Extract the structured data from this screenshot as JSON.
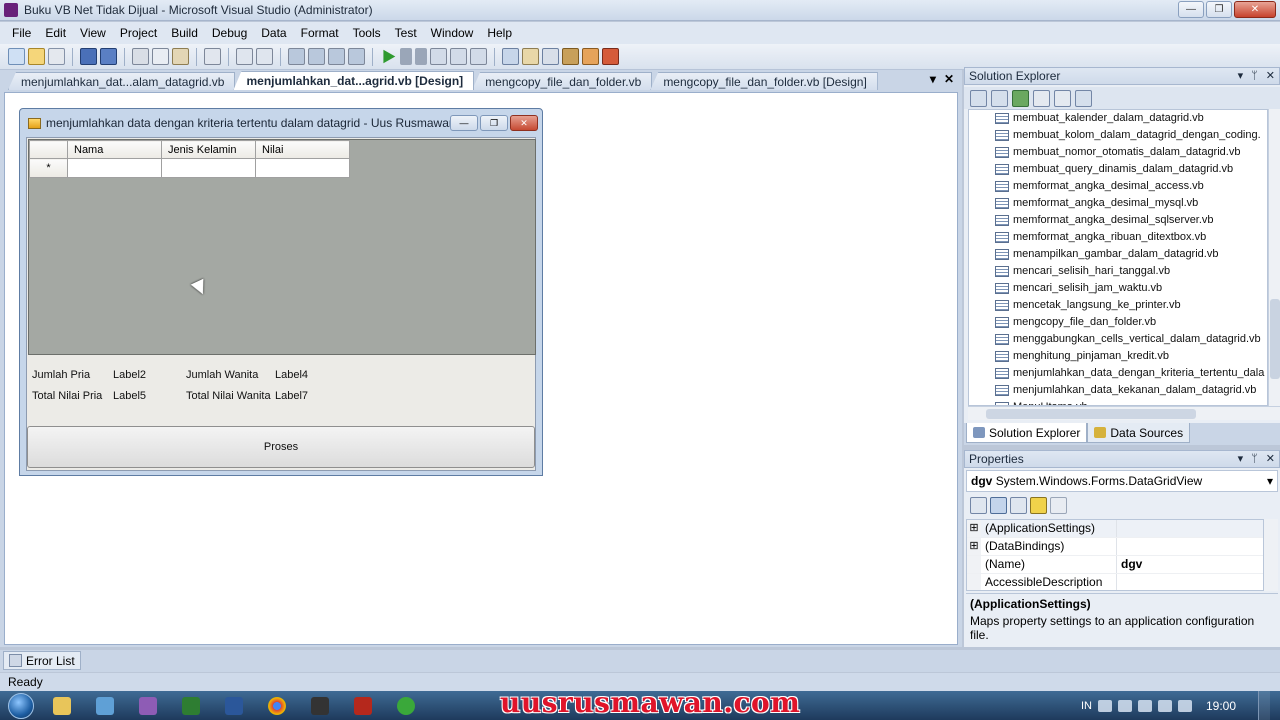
{
  "window": {
    "title": "Buku VB Net Tidak Dijual - Microsoft Visual Studio (Administrator)",
    "min_label": "—",
    "max_label": "❐",
    "close_label": "✕"
  },
  "menu": [
    "File",
    "Edit",
    "View",
    "Project",
    "Build",
    "Debug",
    "Data",
    "Format",
    "Tools",
    "Test",
    "Window",
    "Help"
  ],
  "doc_tabs": [
    {
      "label": "menjumlahkan_dat...alam_datagrid.vb",
      "active": false
    },
    {
      "label": "menjumlahkan_dat...agrid.vb [Design]",
      "active": true
    },
    {
      "label": "mengcopy_file_dan_folder.vb",
      "active": false
    },
    {
      "label": "mengcopy_file_dan_folder.vb [Design]",
      "active": false
    }
  ],
  "tab_controls": {
    "dropdown": "▾",
    "close": "✕"
  },
  "form": {
    "title": "menjumlahkan data dengan kriteria tertentu dalam datagrid - Uus Rusmawan",
    "grid": {
      "columns": [
        "Nama",
        "Jenis Kelamin",
        "Nilai"
      ],
      "new_row_marker": "*"
    },
    "labels": {
      "jumlah_pria": "Jumlah Pria",
      "label2": "Label2",
      "jumlah_wanita": "Jumlah Wanita",
      "label4": "Label4",
      "total_nilai_pria": "Total Nilai Pria",
      "label5": "Label5",
      "total_nilai_wanita": "Total Nilai Wanita",
      "label7": "Label7"
    },
    "button_label": "Proses"
  },
  "solution_explorer": {
    "title": "Solution Explorer",
    "controls": {
      "dropdown": "▾",
      "pin": "ᛘ",
      "close": "✕"
    },
    "files": [
      "membuat_kalender_dalam_datagrid.vb",
      "membuat_kolom_dalam_datagrid_dengan_coding.",
      "membuat_nomor_otomatis_dalam_datagrid.vb",
      "membuat_query_dinamis_dalam_datagrid.vb",
      "memformat_angka_desimal_access.vb",
      "memformat_angka_desimal_mysql.vb",
      "memformat_angka_desimal_sqlserver.vb",
      "memformat_angka_ribuan_ditextbox.vb",
      "menampilkan_gambar_dalam_datagrid.vb",
      "mencari_selisih_hari_tanggal.vb",
      "mencari_selisih_jam_waktu.vb",
      "mencetak_langsung_ke_printer.vb",
      "mengcopy_file_dan_folder.vb",
      "menggabungkan_cells_vertical_dalam_datagrid.vb",
      "menghitung_pinjaman_kredit.vb",
      "menjumlahkan_data_dengan_kriteria_tertentu_dala",
      "menjumlahkan_data_kekanan_dalam_datagrid.vb",
      "MenuUtama.vb"
    ],
    "tabs": [
      "Solution Explorer",
      "Data Sources"
    ]
  },
  "properties": {
    "title": "Properties",
    "object_name": "dgv",
    "object_type": "System.Windows.Forms.DataGridView",
    "rows": [
      {
        "expand": "⊞",
        "name": "(ApplicationSettings)",
        "value": ""
      },
      {
        "expand": "⊞",
        "name": "(DataBindings)",
        "value": ""
      },
      {
        "expand": "",
        "name": "(Name)",
        "value": "dgv"
      },
      {
        "expand": "",
        "name": "AccessibleDescription",
        "value": ""
      }
    ],
    "desc_title": "(ApplicationSettings)",
    "desc_text": "Maps property settings to an application configuration file."
  },
  "error_list_label": "Error List",
  "status": "Ready",
  "taskbar": {
    "watermark": "uusrusmawan.com",
    "lang": "IN",
    "time": "19:00"
  },
  "colors": {
    "accent": "#68217a",
    "grid_background": "#a4a8a3",
    "watermark": "#e0142a"
  }
}
